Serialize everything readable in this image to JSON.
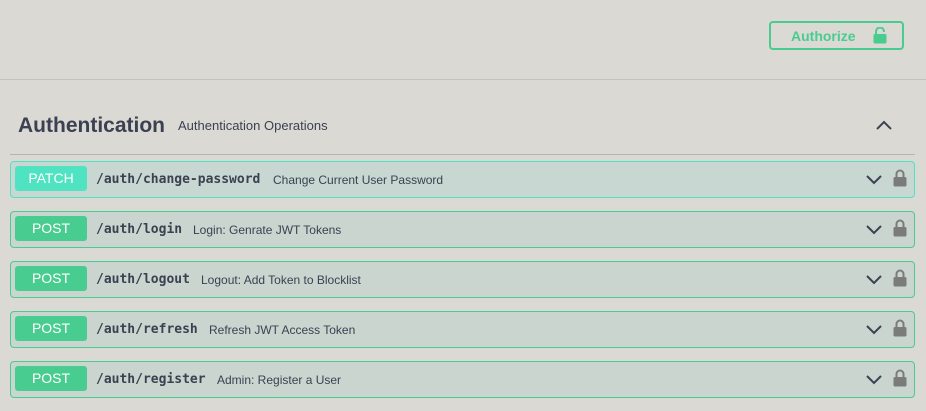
{
  "header": {
    "authorize_label": "Authorize",
    "authorize_icon": "unlocked-icon",
    "accent_color": "#49cc90"
  },
  "section": {
    "title": "Authentication",
    "description": "Authentication Operations",
    "toggle_icon": "chevron-up-icon"
  },
  "operations": [
    {
      "method": "PATCH",
      "path": "/auth/change-password",
      "summary": "Change Current User Password",
      "color": "#50e3c2"
    },
    {
      "method": "POST",
      "path": "/auth/login",
      "summary": "Login: Genrate JWT Tokens",
      "color": "#49cc90"
    },
    {
      "method": "POST",
      "path": "/auth/logout",
      "summary": "Logout: Add Token to Blocklist",
      "color": "#49cc90"
    },
    {
      "method": "POST",
      "path": "/auth/refresh",
      "summary": "Refresh JWT Access Token",
      "color": "#49cc90"
    },
    {
      "method": "POST",
      "path": "/auth/register",
      "summary": "Admin: Register a User",
      "color": "#49cc90"
    }
  ]
}
